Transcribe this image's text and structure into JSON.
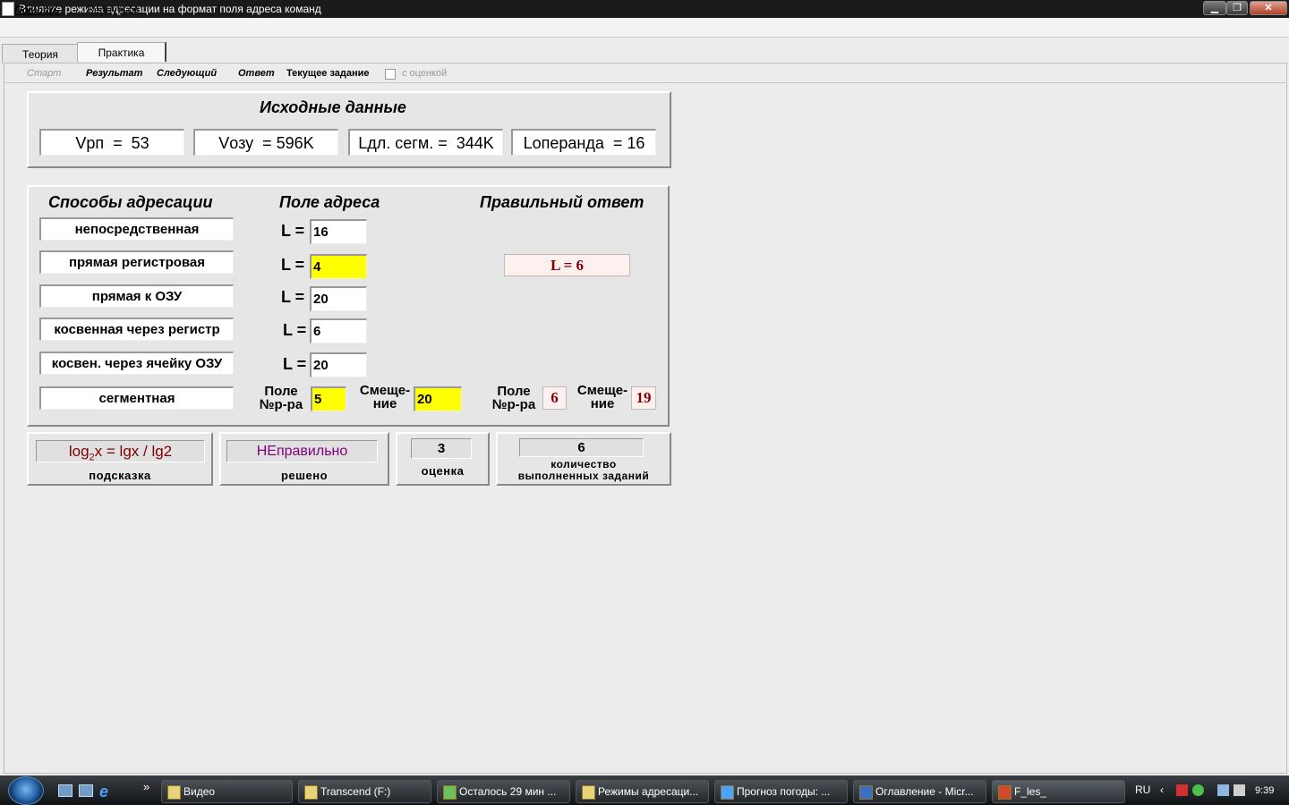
{
  "window": {
    "title": "Влияние режима адресации на формат поля адреса команд"
  },
  "menu": {
    "help": "Помощь",
    "back": "Вернуться"
  },
  "tabs": {
    "theory": "Теория",
    "practice": "Практика"
  },
  "toolbar": {
    "start": "Старт",
    "result": "Результат",
    "next": "Следующий",
    "answer": "Ответ",
    "current_task": "Текущее задание",
    "with_grade": "с оценкой",
    "with_grade_checked": false
  },
  "source": {
    "title": "Исходные данные",
    "fields": [
      "Vрп  =  53",
      "Vозу  = 596K",
      "Lдл. сегм. =  344K",
      "Lоперанда  = 16"
    ]
  },
  "main": {
    "col_modes": "Способы адресации",
    "col_field": "Поле адреса",
    "col_correct": "Правильный ответ",
    "rows": [
      {
        "mode": "непосредственная",
        "l_label": "L =",
        "value": "16"
      },
      {
        "mode": "прямая регистровая",
        "l_label": "L =",
        "value": "4"
      },
      {
        "mode": "прямая к ОЗУ",
        "l_label": "L =",
        "value": "20"
      },
      {
        "mode": "косвенная через регистр",
        "l_label": "L =",
        "value": "6"
      },
      {
        "mode": "косвен. через ячейку ОЗУ",
        "l_label": "L =",
        "value": "20"
      }
    ],
    "segment": {
      "mode": "сегментная",
      "reg_label_1": "Поле",
      "reg_label_2": "№р-ра",
      "reg_value": "5",
      "off_label_1": "Смеще-",
      "off_label_2": "ние",
      "off_value": "20"
    },
    "correct_answer": "L = 6",
    "correct_segment": {
      "reg_label_1": "Поле",
      "reg_label_2": "№р-ра",
      "reg_value": "6",
      "off_label_1": "Смеще-",
      "off_label_2": "ние",
      "off_value": "19"
    }
  },
  "bottom": {
    "hint_formula_pre": "log",
    "hint_formula_sub": "2",
    "hint_formula_post": "x = lgx / lg2",
    "hint_caption": "подсказка",
    "solved_value": "НЕправильно",
    "solved_caption": "решено",
    "grade_value": "3",
    "grade_caption": "оценка",
    "count_value": "6",
    "count_caption_1": "количество",
    "count_caption_2": "выполненных заданий"
  },
  "taskbar": {
    "items": [
      "Видео",
      "Transcend (F:)",
      "Осталось 29 мин ...",
      "Режимы адресаци...",
      "Прогноз погоды: ...",
      "Оглавление - Micr...",
      "F_les_"
    ],
    "lang": "RU",
    "clock": "9:39",
    "more": "»"
  },
  "colors": {
    "accent_answer": "#800000",
    "highlight": "#ffff00",
    "solved_text": "#800080"
  }
}
